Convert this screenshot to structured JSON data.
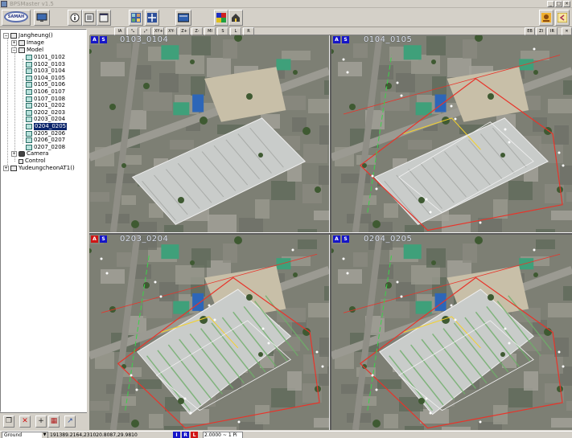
{
  "window": {
    "title": "BPSMaster v1.5"
  },
  "toolbar": {
    "logo_text": "SAMAH",
    "buttons": [
      {
        "name": "logo-button",
        "icon": "app-logo-icon"
      },
      {
        "name": "monitor-button",
        "icon": "monitor-icon"
      },
      {
        "name": "info-button",
        "icon": "info-icon"
      },
      {
        "name": "frame-button",
        "icon": "frame-icon"
      },
      {
        "name": "window-button",
        "icon": "window-icon"
      },
      {
        "name": "image-grid-button",
        "icon": "image-grid-icon"
      },
      {
        "name": "pan-button",
        "icon": "pan-icon"
      },
      {
        "name": "display-button",
        "icon": "display-icon"
      },
      {
        "name": "palette-button",
        "icon": "palette-icon"
      },
      {
        "name": "home-button",
        "icon": "home-icon"
      },
      {
        "name": "export-button",
        "icon": "export-icon"
      },
      {
        "name": "exit-button",
        "icon": "exit-icon"
      }
    ]
  },
  "tree": {
    "root1": "Jangheung()",
    "image": "Image",
    "model": "Model",
    "models": [
      "0101_0102",
      "0102_0103",
      "0103_0104",
      "0104_0105",
      "0105_0106",
      "0106_0107",
      "0107_0108",
      "0201_0202",
      "0202_0203",
      "0203_0204",
      "0204_0205",
      "0205_0206",
      "0206_0207",
      "0207_0208"
    ],
    "selected_index": 10,
    "camera": "Camera",
    "control": "Control",
    "root2": "YudeungcheonAT1()"
  },
  "tree_toolbar": [
    {
      "name": "new-button",
      "icon": "new-page-icon",
      "glyph": "❐"
    },
    {
      "name": "delete-button",
      "icon": "delete-x-icon",
      "glyph": "✕"
    },
    {
      "name": "add-button",
      "icon": "add-icon",
      "glyph": "+"
    },
    {
      "name": "grid-button",
      "icon": "grid-icon",
      "glyph": "▦"
    },
    {
      "name": "export-tree-button",
      "icon": "export-arrow-icon",
      "glyph": "↗"
    }
  ],
  "view_toolbar": {
    "left": [
      "IA",
      "⤡",
      "⤢",
      "XY+",
      "XY-",
      "Z+",
      "Z-",
      "MI",
      "S",
      "L",
      "R"
    ],
    "right": [
      "EB",
      "ZI",
      "IR",
      "✕"
    ]
  },
  "panes": [
    {
      "label": "0103_0104",
      "badges": [
        "A",
        "S"
      ],
      "colors": [
        "#1515c8",
        "#1515c8"
      ]
    },
    {
      "label": "0104_0105",
      "badges": [
        "A",
        "S"
      ],
      "colors": [
        "#1515c8",
        "#1515c8"
      ]
    },
    {
      "label": "0203_0204",
      "badges": [
        "A",
        "S"
      ],
      "colors": [
        "#d01515",
        "#1515c8"
      ]
    },
    {
      "label": "0204_0205",
      "badges": [
        "A",
        "S"
      ],
      "colors": [
        "#1515c8",
        "#1515c8"
      ]
    }
  ],
  "status": {
    "layer": "Ground",
    "coords": "191389.2164,231020.8087,29.9810",
    "indicators": [
      {
        "text": "I",
        "color": "#1515c8"
      },
      {
        "text": "R",
        "color": "#1515c8"
      },
      {
        "text": "L",
        "color": "#d01515"
      }
    ],
    "scale": "2.0000 ~ 1 Pi"
  },
  "colors": {
    "selection": "#0a246a",
    "rooftop": "#c9ccca",
    "green_roof": "#3fa07a",
    "blue_roof": "#2d66b8",
    "vector_red": "#e8342a",
    "vector_yellow": "#f5d22a"
  }
}
